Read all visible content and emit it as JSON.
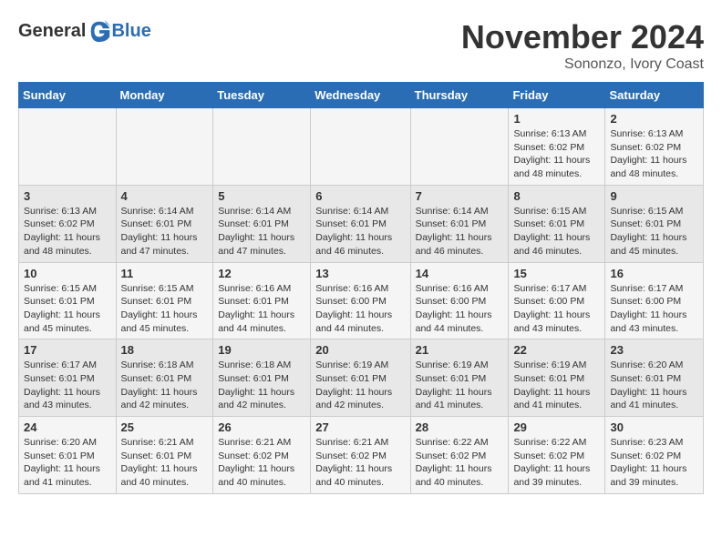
{
  "header": {
    "logo_general": "General",
    "logo_blue": "Blue",
    "month_title": "November 2024",
    "location": "Sononzo, Ivory Coast"
  },
  "calendar": {
    "days_of_week": [
      "Sunday",
      "Monday",
      "Tuesday",
      "Wednesday",
      "Thursday",
      "Friday",
      "Saturday"
    ],
    "weeks": [
      [
        {
          "day": "",
          "info": ""
        },
        {
          "day": "",
          "info": ""
        },
        {
          "day": "",
          "info": ""
        },
        {
          "day": "",
          "info": ""
        },
        {
          "day": "",
          "info": ""
        },
        {
          "day": "1",
          "info": "Sunrise: 6:13 AM\nSunset: 6:02 PM\nDaylight: 11 hours and 48 minutes."
        },
        {
          "day": "2",
          "info": "Sunrise: 6:13 AM\nSunset: 6:02 PM\nDaylight: 11 hours and 48 minutes."
        }
      ],
      [
        {
          "day": "3",
          "info": "Sunrise: 6:13 AM\nSunset: 6:02 PM\nDaylight: 11 hours and 48 minutes."
        },
        {
          "day": "4",
          "info": "Sunrise: 6:14 AM\nSunset: 6:01 PM\nDaylight: 11 hours and 47 minutes."
        },
        {
          "day": "5",
          "info": "Sunrise: 6:14 AM\nSunset: 6:01 PM\nDaylight: 11 hours and 47 minutes."
        },
        {
          "day": "6",
          "info": "Sunrise: 6:14 AM\nSunset: 6:01 PM\nDaylight: 11 hours and 46 minutes."
        },
        {
          "day": "7",
          "info": "Sunrise: 6:14 AM\nSunset: 6:01 PM\nDaylight: 11 hours and 46 minutes."
        },
        {
          "day": "8",
          "info": "Sunrise: 6:15 AM\nSunset: 6:01 PM\nDaylight: 11 hours and 46 minutes."
        },
        {
          "day": "9",
          "info": "Sunrise: 6:15 AM\nSunset: 6:01 PM\nDaylight: 11 hours and 45 minutes."
        }
      ],
      [
        {
          "day": "10",
          "info": "Sunrise: 6:15 AM\nSunset: 6:01 PM\nDaylight: 11 hours and 45 minutes."
        },
        {
          "day": "11",
          "info": "Sunrise: 6:15 AM\nSunset: 6:01 PM\nDaylight: 11 hours and 45 minutes."
        },
        {
          "day": "12",
          "info": "Sunrise: 6:16 AM\nSunset: 6:01 PM\nDaylight: 11 hours and 44 minutes."
        },
        {
          "day": "13",
          "info": "Sunrise: 6:16 AM\nSunset: 6:00 PM\nDaylight: 11 hours and 44 minutes."
        },
        {
          "day": "14",
          "info": "Sunrise: 6:16 AM\nSunset: 6:00 PM\nDaylight: 11 hours and 44 minutes."
        },
        {
          "day": "15",
          "info": "Sunrise: 6:17 AM\nSunset: 6:00 PM\nDaylight: 11 hours and 43 minutes."
        },
        {
          "day": "16",
          "info": "Sunrise: 6:17 AM\nSunset: 6:00 PM\nDaylight: 11 hours and 43 minutes."
        }
      ],
      [
        {
          "day": "17",
          "info": "Sunrise: 6:17 AM\nSunset: 6:01 PM\nDaylight: 11 hours and 43 minutes."
        },
        {
          "day": "18",
          "info": "Sunrise: 6:18 AM\nSunset: 6:01 PM\nDaylight: 11 hours and 42 minutes."
        },
        {
          "day": "19",
          "info": "Sunrise: 6:18 AM\nSunset: 6:01 PM\nDaylight: 11 hours and 42 minutes."
        },
        {
          "day": "20",
          "info": "Sunrise: 6:19 AM\nSunset: 6:01 PM\nDaylight: 11 hours and 42 minutes."
        },
        {
          "day": "21",
          "info": "Sunrise: 6:19 AM\nSunset: 6:01 PM\nDaylight: 11 hours and 41 minutes."
        },
        {
          "day": "22",
          "info": "Sunrise: 6:19 AM\nSunset: 6:01 PM\nDaylight: 11 hours and 41 minutes."
        },
        {
          "day": "23",
          "info": "Sunrise: 6:20 AM\nSunset: 6:01 PM\nDaylight: 11 hours and 41 minutes."
        }
      ],
      [
        {
          "day": "24",
          "info": "Sunrise: 6:20 AM\nSunset: 6:01 PM\nDaylight: 11 hours and 41 minutes."
        },
        {
          "day": "25",
          "info": "Sunrise: 6:21 AM\nSunset: 6:01 PM\nDaylight: 11 hours and 40 minutes."
        },
        {
          "day": "26",
          "info": "Sunrise: 6:21 AM\nSunset: 6:02 PM\nDaylight: 11 hours and 40 minutes."
        },
        {
          "day": "27",
          "info": "Sunrise: 6:21 AM\nSunset: 6:02 PM\nDaylight: 11 hours and 40 minutes."
        },
        {
          "day": "28",
          "info": "Sunrise: 6:22 AM\nSunset: 6:02 PM\nDaylight: 11 hours and 40 minutes."
        },
        {
          "day": "29",
          "info": "Sunrise: 6:22 AM\nSunset: 6:02 PM\nDaylight: 11 hours and 39 minutes."
        },
        {
          "day": "30",
          "info": "Sunrise: 6:23 AM\nSunset: 6:02 PM\nDaylight: 11 hours and 39 minutes."
        }
      ]
    ]
  }
}
